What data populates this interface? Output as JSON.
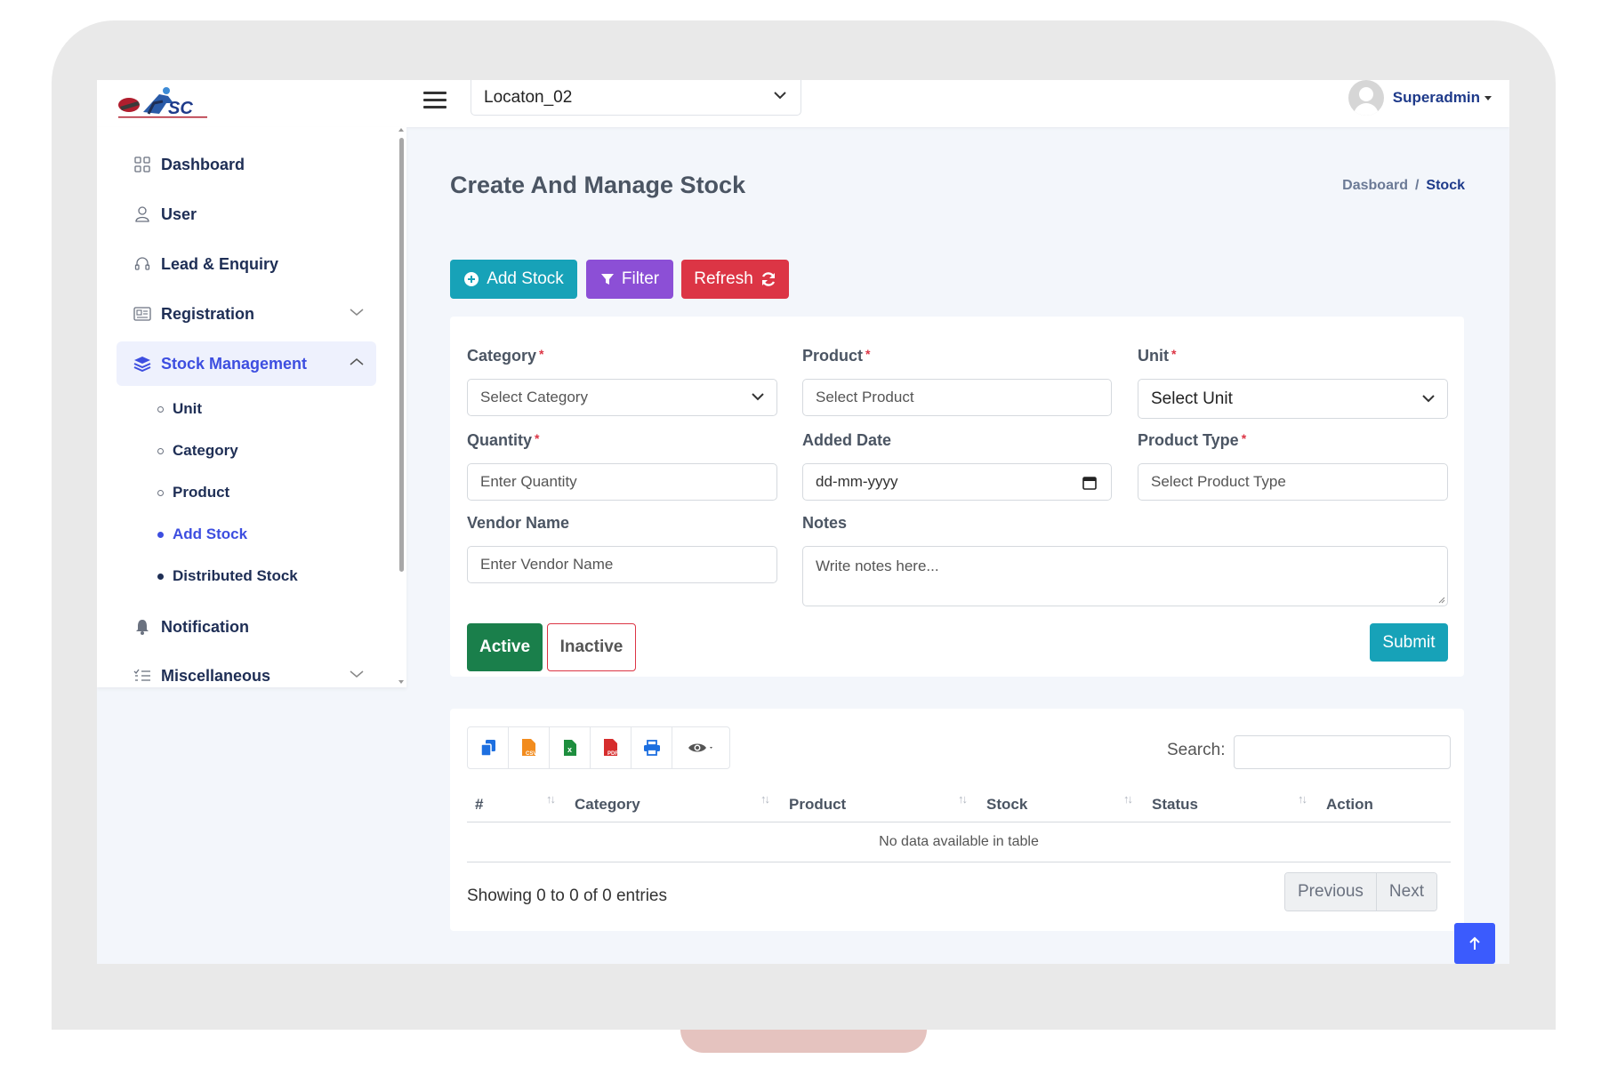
{
  "header": {
    "location_select": "Locaton_02",
    "user_name": "Superadmin"
  },
  "sidebar": {
    "items": [
      {
        "label": "Dashboard",
        "icon": "grid-icon"
      },
      {
        "label": "User",
        "icon": "user-icon"
      },
      {
        "label": "Lead & Enquiry",
        "icon": "headset-icon"
      },
      {
        "label": "Registration",
        "icon": "id-card-icon"
      },
      {
        "label": "Stock Management",
        "icon": "layers-icon"
      },
      {
        "label": "Notification",
        "icon": "bell-icon"
      },
      {
        "label": "Miscellaneous",
        "icon": "list-check-icon"
      }
    ],
    "sub_items": [
      {
        "label": "Unit"
      },
      {
        "label": "Category"
      },
      {
        "label": "Product"
      },
      {
        "label": "Add Stock"
      },
      {
        "label": "Distributed Stock"
      }
    ]
  },
  "page": {
    "title": "Create And Manage Stock",
    "breadcrumb": {
      "link": "Dasboard",
      "separator": "/",
      "current": "Stock"
    }
  },
  "actions": {
    "add_stock": "Add Stock",
    "filter": "Filter",
    "refresh": "Refresh"
  },
  "form": {
    "category": {
      "label": "Category",
      "placeholder": "Select Category"
    },
    "product": {
      "label": "Product",
      "placeholder": "Select Product"
    },
    "unit": {
      "label": "Unit",
      "placeholder": "Select Unit"
    },
    "quantity": {
      "label": "Quantity",
      "placeholder": "Enter Quantity"
    },
    "added_date": {
      "label": "Added Date",
      "placeholder": "dd-mm-yyyy"
    },
    "product_type": {
      "label": "Product Type",
      "placeholder": "Select Product Type"
    },
    "vendor_name": {
      "label": "Vendor Name",
      "placeholder": "Enter Vendor Name"
    },
    "notes": {
      "label": "Notes",
      "placeholder": "Write notes here..."
    },
    "required_mark": "*",
    "active_label": "Active",
    "inactive_label": "Inactive",
    "submit_label": "Submit"
  },
  "table": {
    "export_buttons": [
      "copy-icon",
      "csv-icon",
      "excel-icon",
      "pdf-icon",
      "print-icon",
      "eye-icon"
    ],
    "search_label": "Search:",
    "columns": [
      "#",
      "Category",
      "Product",
      "Stock",
      "Status",
      "Action"
    ],
    "empty_message": "No data available in table",
    "info": "Showing 0 to 0 of 0 entries",
    "previous": "Previous",
    "next": "Next"
  },
  "colors": {
    "primary": "#3d4ee0",
    "teal": "#17a2b8",
    "purple": "#8c4fd6",
    "red": "#dc3545",
    "green": "#1a7f4b"
  }
}
